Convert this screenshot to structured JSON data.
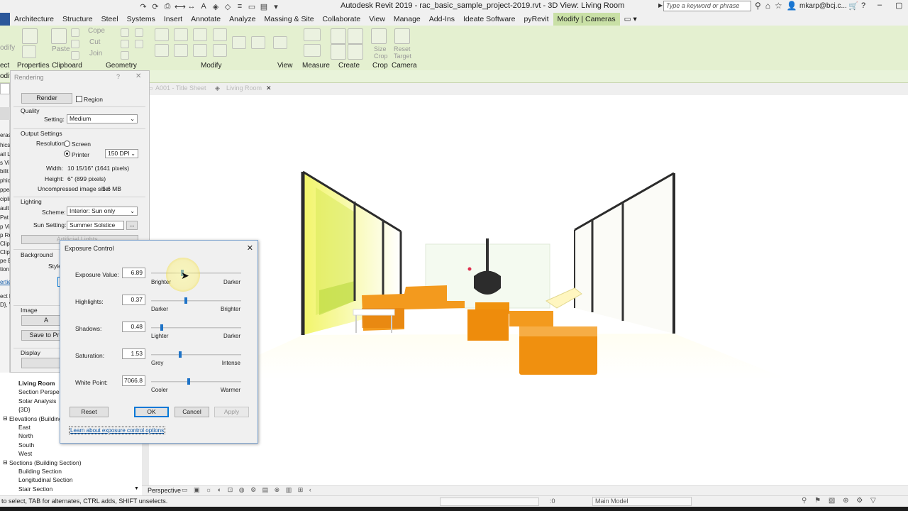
{
  "window": {
    "title": "Autodesk Revit 2019 - rac_basic_sample_project-2019.rvt - 3D View: Living Room",
    "search_placeholder": "Type a keyword or phrase",
    "user": "mkarp@bcj.c..."
  },
  "ribbon_tabs": [
    "Architecture",
    "Structure",
    "Steel",
    "Systems",
    "Insert",
    "Annotate",
    "Analyze",
    "Massing & Site",
    "Collaborate",
    "View",
    "Manage",
    "Add-Ins",
    "Ideate Software",
    "pyRevit",
    "Modify | Cameras"
  ],
  "ribbon_panels": {
    "select": "ect",
    "properties": "Properties",
    "clipboard": "Clipboard",
    "geometry": "Geometry",
    "modify": "Modify",
    "view": "View",
    "measure": "Measure",
    "create": "Create",
    "crop": "Crop",
    "camera": "Camera",
    "small_labels": {
      "modify": "odify",
      "paste": "Paste",
      "cope": "Cope",
      "cut": "Cut",
      "join": "Join",
      "size_crop": "Size Crop",
      "reset_target": "Reset Target"
    }
  },
  "options_bar": {
    "left_label": "odify"
  },
  "left_palette": [
    "eras",
    "hics",
    "ail L",
    "s Vi",
    "bilit",
    "phic",
    "ppea",
    "cipli",
    "ault",
    "Pat",
    "p Vi",
    "p Re",
    "Clip",
    "Clip",
    "pe E",
    "tion",
    "ertie",
    "ect E",
    "D}, V"
  ],
  "view_tabs": {
    "tab1": "A001 - Title Sheet",
    "tab2": "Living Room",
    "close": "✕"
  },
  "rendering_dialog": {
    "title": "Rendering",
    "help": "?",
    "close": "✕",
    "render_button": "Render",
    "region_label": "Region",
    "quality": {
      "group": "Quality",
      "setting_label": "Setting:",
      "setting_value": "Medium"
    },
    "output": {
      "group": "Output Settings",
      "resolution_label": "Resolution:",
      "screen_label": "Screen",
      "printer_label": "Printer",
      "dpi_value": "150 DPI",
      "width_label": "Width:",
      "width_value": "10 15/16\" (1641 pixels)",
      "height_label": "Height:",
      "height_value": "6\" (899 pixels)",
      "uncompressed_label": "Uncompressed image size:",
      "uncompressed_value": "5.6 MB"
    },
    "lighting": {
      "group": "Lighting",
      "scheme_label": "Scheme:",
      "scheme_value": "Interior: Sun only",
      "sun_label": "Sun Setting:",
      "sun_value": "Summer Solstice",
      "ellipsis": "...",
      "artificial_button": "Artificial Lights..."
    },
    "background": {
      "group": "Background",
      "style_label": "Style"
    },
    "image": {
      "group": "Image",
      "adjust_button": "A",
      "save_button": "Save to Pro"
    },
    "display": {
      "group": "Display"
    }
  },
  "project_browser": {
    "items": [
      {
        "label": "Living Room",
        "bold": true
      },
      {
        "label": "Section Perspec"
      },
      {
        "label": "Solar Analysis"
      },
      {
        "label": "{3D}"
      },
      {
        "label": "Elevations (Building"
      },
      {
        "label": "East"
      },
      {
        "label": "North"
      },
      {
        "label": "South"
      },
      {
        "label": "West"
      },
      {
        "label": "Sections (Building Section)"
      },
      {
        "label": "Building Section"
      },
      {
        "label": "Longitudinal Section"
      },
      {
        "label": "Stair Section"
      }
    ]
  },
  "exposure_dialog": {
    "title": "Exposure Control",
    "close": "✕",
    "rows": [
      {
        "label": "Exposure Value:",
        "value": "6.89",
        "left": "Brighter",
        "right": "Darker",
        "level": 0.33
      },
      {
        "label": "Highlights:",
        "value": "0.37",
        "left": "Darker",
        "right": "Brighter",
        "level": 0.37
      },
      {
        "label": "Shadows:",
        "value": "0.48",
        "left": "Lighter",
        "right": "Darker",
        "level": 0.1
      },
      {
        "label": "Saturation:",
        "value": "1.53",
        "left": "Grey",
        "right": "Intense",
        "level": 0.31
      },
      {
        "label": "White Point:",
        "value": "7066.8",
        "left": "Cooler",
        "right": "Warmer",
        "level": 0.4
      }
    ],
    "reset_button": "Reset",
    "ok_button": "OK",
    "cancel_button": "Cancel",
    "apply_button": "Apply",
    "learn_link": "Learn about exposure control options"
  },
  "view_control_bar": {
    "label": "Perspective"
  },
  "status_bar": {
    "message": "to select, TAB for alternates, CTRL adds, SHIFT unselects.",
    "workset": "Main Model",
    "zero": ":0"
  },
  "colors": {
    "ribbon_green": "#e4f0d0",
    "active_tab": "#c9e0a6",
    "slider_blue": "#1e73c7",
    "orange_furniture": "#f39a1e"
  }
}
